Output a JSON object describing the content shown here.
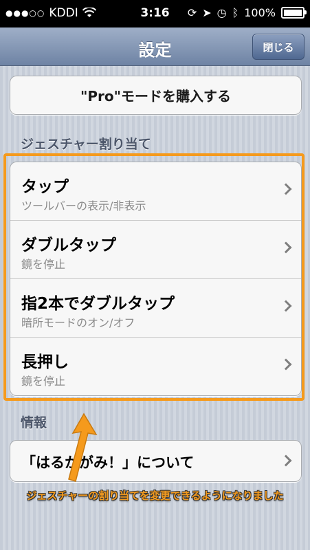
{
  "status_bar": {
    "carrier": "KDDI",
    "time": "3:16",
    "battery": "100%"
  },
  "nav": {
    "title": "設定",
    "close_label": "閉じる"
  },
  "pro_button_label": "\"Pro\"モードを購入する",
  "gesture_section": {
    "header": "ジェスチャー割り当て",
    "items": [
      {
        "title": "タップ",
        "subtitle": "ツールバーの表示/非表示"
      },
      {
        "title": "ダブルタップ",
        "subtitle": "鏡を停止"
      },
      {
        "title": "指2本でダブルタップ",
        "subtitle": "暗所モードのオン/オフ"
      },
      {
        "title": "長押し",
        "subtitle": "鏡を停止"
      }
    ]
  },
  "info_section": {
    "header": "情報",
    "about_label": "「はるかがみ！」について"
  },
  "annotation": {
    "caption": "ジェスチャーの割り当てを変更できるようになりました",
    "color": "#f59a1c"
  }
}
